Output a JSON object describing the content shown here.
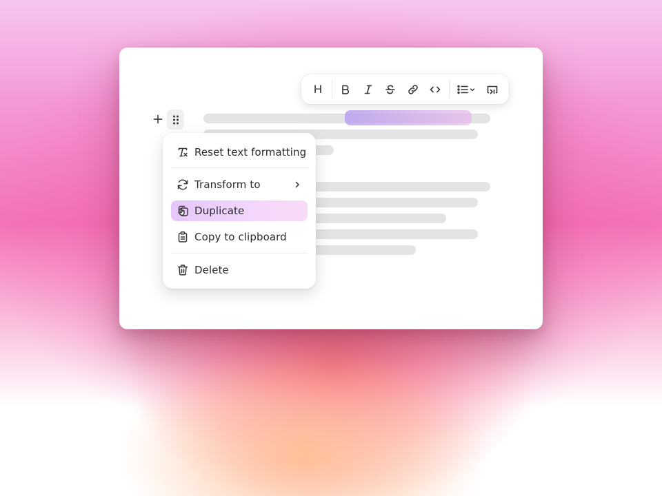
{
  "toolbar": {
    "heading_label": "H",
    "buttons": [
      {
        "name": "heading-button",
        "icon": "heading-icon"
      },
      {
        "name": "bold-button",
        "icon": "bold-icon"
      },
      {
        "name": "italic-button",
        "icon": "italic-icon"
      },
      {
        "name": "strikethrough-button",
        "icon": "strikethrough-icon"
      },
      {
        "name": "link-button",
        "icon": "link-icon"
      },
      {
        "name": "code-button",
        "icon": "code-icon"
      },
      {
        "name": "list-dropdown-button",
        "icon": "bullet-list-icon"
      },
      {
        "name": "block-button",
        "icon": "block-icon"
      }
    ]
  },
  "block_handle": {
    "add_icon": "plus-icon",
    "drag_icon": "drag-handle-icon"
  },
  "menu": {
    "items": [
      {
        "label": "Reset text formatting",
        "icon": "clear-formatting-icon"
      },
      {
        "label": "Transform to",
        "icon": "transform-icon",
        "submenu": true
      },
      {
        "label": "Duplicate",
        "icon": "duplicate-icon",
        "active": true
      },
      {
        "label": "Copy to clipboard",
        "icon": "clipboard-icon"
      },
      {
        "label": "Delete",
        "icon": "trash-icon"
      }
    ]
  },
  "colors": {
    "active_item_start": "#e6c7fb",
    "active_item_end": "#f9dbf7",
    "selection": "#b496f0",
    "skeleton": "#e4e4e4"
  }
}
